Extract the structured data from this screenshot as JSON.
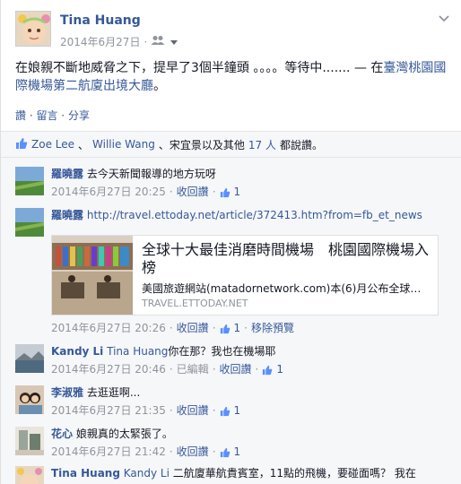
{
  "post": {
    "author": "Tina Huang",
    "date": "2014年6月27日",
    "privacy_icon": "friends-icon",
    "text_main": "在娘親不斷地威脅之下，提早了3個半鐘頭 。。。。等待中....... — 在",
    "location": "臺灣桃園國際機場第二航廈出境大廳",
    "text_end": "。"
  },
  "actions": {
    "like": "讚",
    "sep1": " · ",
    "comment": "留言",
    "sep2": " · ",
    "share": "分享"
  },
  "likes": {
    "name1": "Zoe Lee",
    "sep1": " 、 ",
    "name2": "Willie Wang",
    "sep2": " 、宋宜景以及其他 ",
    "count": "17 人",
    "suffix": "都說讚。"
  },
  "comments": [
    {
      "name": "羅曉露",
      "text": "去今天新聞報導的地方玩呀",
      "time": "2014年6月27日 20:25",
      "retract": "收回讚",
      "likes": "1"
    },
    {
      "name": "羅曉露",
      "text": "http://travel.ettoday.net/article/372413.htm?from=fb_et_news",
      "preview_title": "全球十大最佳消磨時間機場　桃園國際機場入榜",
      "preview_desc": "美國旅遊網站(matadornetwork.com)本(6)月公布全球…",
      "preview_domain": "TRAVEL.ETTODAY.NET",
      "time": "2014年6月27日 20:26",
      "retract": "收回讚",
      "likes": "1",
      "remove": "移除預覽"
    },
    {
      "name": "Kandy Li",
      "tag": "Tina Huang",
      "text": "你在那？我也在機場耶",
      "time": "2014年6月27日 20:46",
      "edited": "已編輯",
      "retract": "收回讚",
      "likes": "1"
    },
    {
      "name": "李淑雅",
      "text": "去逛逛啊...",
      "time": "2014年6月27日 21:35",
      "retract": "收回讚",
      "likes": "1"
    },
    {
      "name": "花心",
      "text": "娘親真的太緊張了。",
      "time": "2014年6月27日 21:42",
      "retract": "收回讚",
      "likes": "1"
    },
    {
      "name": "Tina Huang",
      "tag": "Kandy Li",
      "text": "二航廈華航貴賓室，11點的飛機，要碰面嗎？ 我在"
    }
  ],
  "colors": {
    "link": "#365899",
    "meta": "#90949c",
    "bg": "#f6f7f9"
  }
}
